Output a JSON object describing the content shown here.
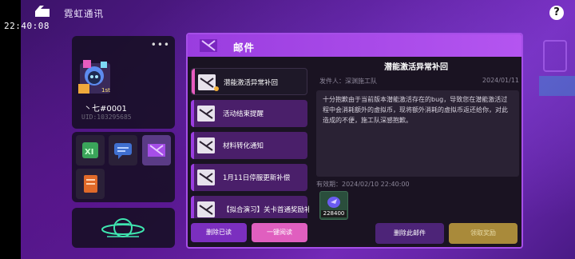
{
  "status": {
    "clock": "22:40:08"
  },
  "topbar": {
    "title": "霓虹通讯",
    "help": "?"
  },
  "profile": {
    "more": "•••",
    "name": "丶七#0001",
    "uid": "UID:103295685",
    "badge": "1st"
  },
  "mail": {
    "header_title": "邮件",
    "items": [
      {
        "title": "潜能激活异常补回",
        "selected": true,
        "unread": true
      },
      {
        "title": "活动结束提醒",
        "selected": false,
        "unread": false
      },
      {
        "title": "材料转化通知",
        "selected": false,
        "unread": false
      },
      {
        "title": "1月11日停服更新补偿",
        "selected": false,
        "unread": false
      },
      {
        "title": "【拟合演习】关卡首通奖励补偿",
        "selected": false,
        "unread": false
      }
    ],
    "delete_read": "删除已读",
    "read_all": "一键阅读"
  },
  "detail": {
    "title": "潜能激活异常补回",
    "sender": "发件人：深渊施工队",
    "date": "2024/01/11",
    "body": "十分抱歉由于当前版本潜能激活存在的bug，导致您在潜能激活过程中会消耗额外的虚拟币，现将额外消耗的虚拟币返还给你，对此造成的不便，施工队深感抱歉。",
    "expire": "有效期：2024/02/10 22:40:00",
    "reward_qty": "228400",
    "delete_this": "删除此邮件",
    "claim": "领取奖励"
  },
  "colors": {
    "accent": "#a64ee8",
    "pink": "#e05fbf",
    "gold": "#a98a3a"
  }
}
